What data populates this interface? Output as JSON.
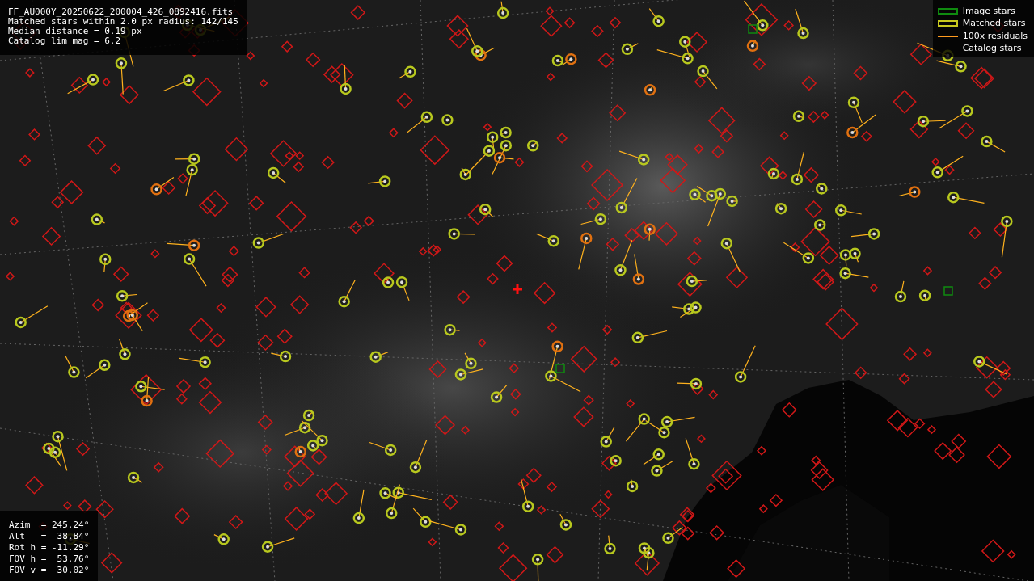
{
  "file_info": {
    "lines": [
      "FF_AU000Y_20250622_200004_426_0892416.fits",
      "Matched stars within 2.0 px radius: 142/145",
      "Median distance = 0.19 px",
      "Catalog lim mag = 6.2"
    ]
  },
  "legend": {
    "items": [
      {
        "label": "Image stars",
        "color": "#0f8a0f"
      },
      {
        "kind": "matched",
        "label": "Matched stars",
        "color": "#c8c81e"
      },
      {
        "kind": "residual",
        "label": "100x residuals",
        "color": "#ff9a1e"
      },
      {
        "kind": "catalog",
        "label": "Catalog stars"
      }
    ]
  },
  "pointing": {
    "lines": [
      "Azim  = 245.24°",
      "Alt   =  38.84°",
      "Rot h = -11.29°",
      "FOV h =  53.76°",
      "FOV v =  30.02°"
    ]
  }
}
